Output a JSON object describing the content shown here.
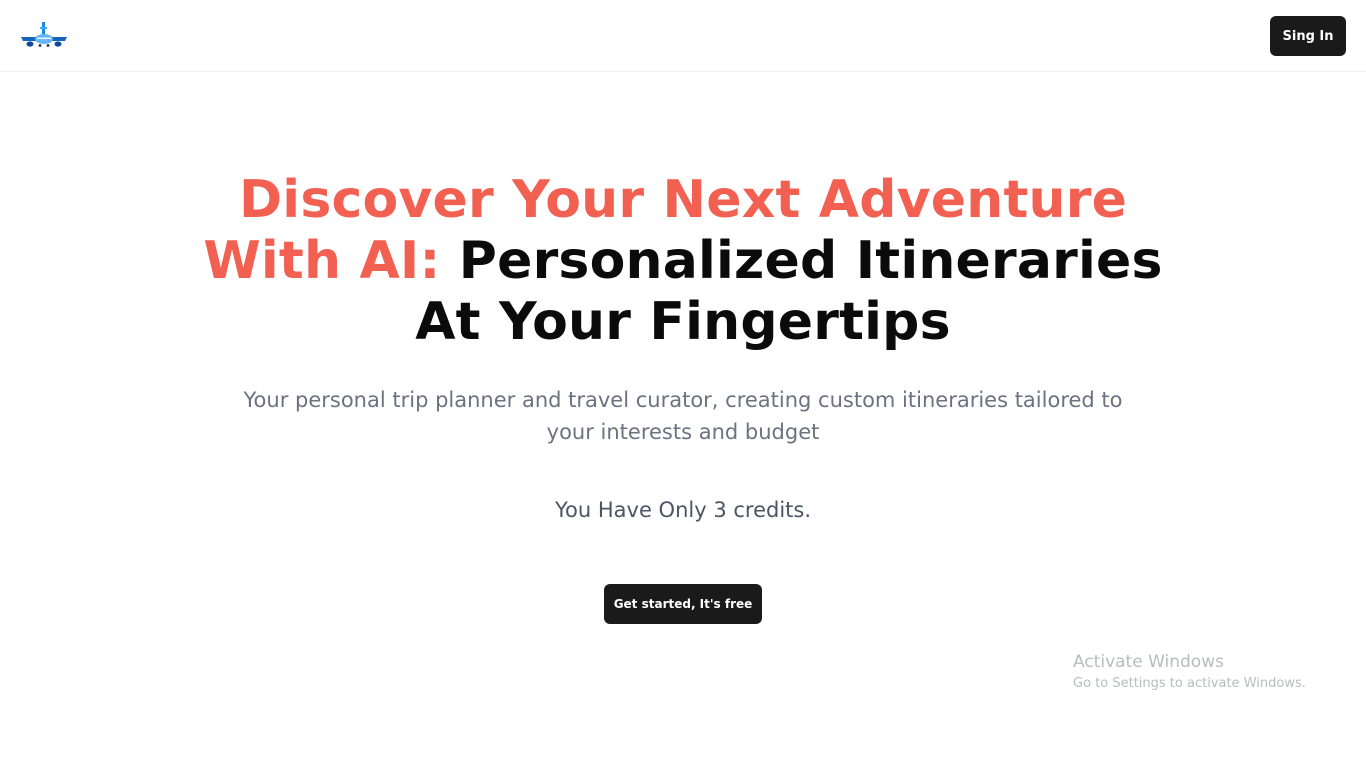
{
  "header": {
    "logo_icon": "airplane-icon",
    "signin_label": "Sing In"
  },
  "hero": {
    "title_accent": "Discover Your Next Adventure With AI:",
    "title_rest": "Personalized Itineraries At Your Fingertips",
    "subtitle": "Your personal trip planner and travel curator, creating custom itineraries tailored to your interests and budget",
    "credits_text": "You Have Only 3 credits.",
    "cta_label": "Get started, It's free"
  },
  "watermark": {
    "title": "Activate Windows",
    "subtitle": "Go to Settings to activate Windows."
  },
  "colors": {
    "accent": "#f26052",
    "button_bg": "#1a1a1a",
    "text_dark": "#0b0b0b",
    "text_muted": "#6b7280"
  }
}
